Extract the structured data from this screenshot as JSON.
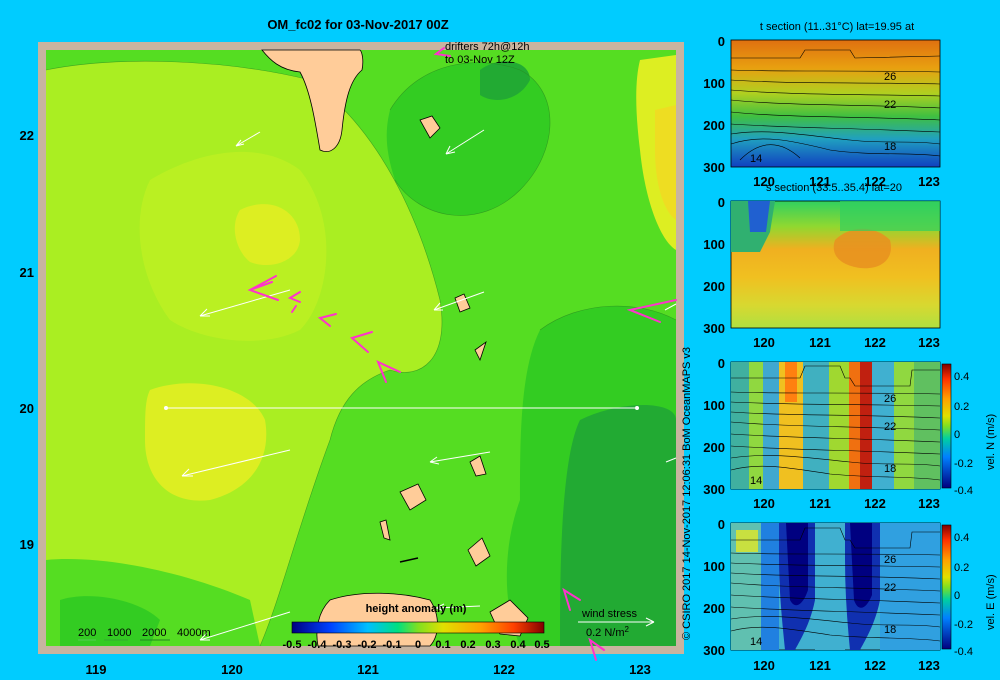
{
  "title": "OM_fc02 for 03-Nov-2017 00Z",
  "drifters_note": [
    "drifters 72h@12h",
    "to 03-Nov 12Z"
  ],
  "map": {
    "x_ticks": [
      "119",
      "120",
      "121",
      "122",
      "123"
    ],
    "y_ticks": [
      "22",
      "21",
      "20",
      "19"
    ],
    "depth_legend": [
      "200",
      "1000",
      "2000",
      "4000m"
    ],
    "colorbar_label": "height anomaly (m)",
    "colorbar_ticks": [
      "-0.5",
      "-0.4",
      "-0.3",
      "-0.2",
      "-0.1",
      "0",
      "0.1",
      "0.2",
      "0.3",
      "0.4",
      "0.5"
    ],
    "wind_label": "wind stress",
    "wind_scale": "0.2 N/m",
    "wind_scale_sup": "2"
  },
  "credit": "© CSIRO 2017   14-Nov-2017 12:06:31 BoM OceanMAPS v3",
  "sections": [
    {
      "title": "t section (11..31°C) lat=19.95 at",
      "y_ticks": [
        "0",
        "100",
        "200",
        "300"
      ],
      "x_ticks": [
        "120",
        "121",
        "122",
        "123"
      ],
      "contour_labels": [
        "26",
        "22",
        "18",
        "14"
      ]
    },
    {
      "title": "s section (33.5..35.4) lat=20",
      "y_ticks": [
        "0",
        "100",
        "200",
        "300"
      ],
      "x_ticks": [
        "120",
        "121",
        "122",
        "123"
      ],
      "contour_labels": []
    },
    {
      "title": "",
      "y_ticks": [
        "0",
        "100",
        "200",
        "300"
      ],
      "x_ticks": [
        "120",
        "121",
        "122",
        "123"
      ],
      "contour_labels": [
        "26",
        "22",
        "18",
        "14"
      ],
      "cbar_ticks": [
        "0.4",
        "0.2",
        "0",
        "-0.2",
        "-0.4"
      ],
      "cbar_label": "vel. N (m/s)"
    },
    {
      "title": "",
      "y_ticks": [
        "0",
        "100",
        "200",
        "300"
      ],
      "x_ticks": [
        "120",
        "121",
        "122",
        "123"
      ],
      "contour_labels": [
        "26",
        "22",
        "18",
        "14"
      ],
      "cbar_ticks": [
        "0.4",
        "0.2",
        "0",
        "-0.2",
        "-0.4"
      ],
      "cbar_label": "vel. E (m/s)"
    }
  ],
  "colors": {
    "background": "#00ccff",
    "land": "#ffcc99",
    "frame": "#c8b4a0",
    "drifter": "#ff33cc",
    "green_light": "#aaee22",
    "green": "#55dd22",
    "green_mid": "#33cc22",
    "green_dark": "#22aa33",
    "yellow": "#ddee22"
  }
}
